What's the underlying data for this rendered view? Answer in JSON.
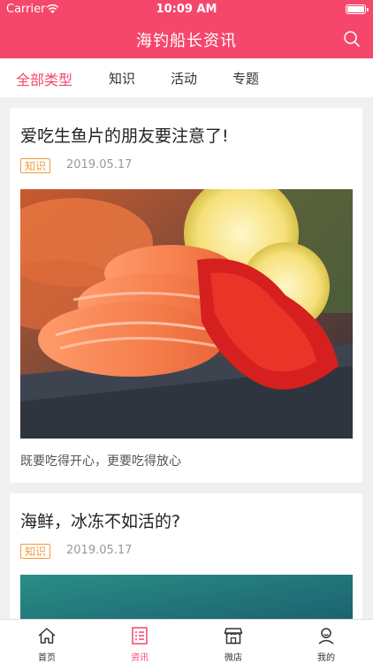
{
  "status_bar": {
    "carrier": "Carrier",
    "time": "10:09 AM",
    "icons": [
      "wifi-icon",
      "battery-icon"
    ]
  },
  "header": {
    "title": "海钓船长资讯",
    "search_icon": "search-icon"
  },
  "tabs": [
    {
      "label": "全部类型",
      "active": true
    },
    {
      "label": "知识",
      "active": false
    },
    {
      "label": "活动",
      "active": false
    },
    {
      "label": "专题",
      "active": false
    }
  ],
  "articles": [
    {
      "title": "爱吃生鱼片的朋友要注意了!",
      "tag": "知识",
      "date": "2019.05.17",
      "summary": "既要吃得开心，更要吃得放心"
    },
    {
      "title": "海鲜，冰冻不如活的?",
      "tag": "知识",
      "date": "2019.05.17"
    }
  ],
  "bottom_nav": [
    {
      "label": "首页",
      "icon": "home-icon",
      "active": false
    },
    {
      "label": "资讯",
      "icon": "news-list-icon",
      "active": true
    },
    {
      "label": "微店",
      "icon": "shop-icon",
      "active": false
    },
    {
      "label": "我的",
      "icon": "profile-icon",
      "active": false
    }
  ],
  "colors": {
    "accent": "#f5476b",
    "tag": "#f19a3e",
    "background": "#f0f0f0"
  }
}
